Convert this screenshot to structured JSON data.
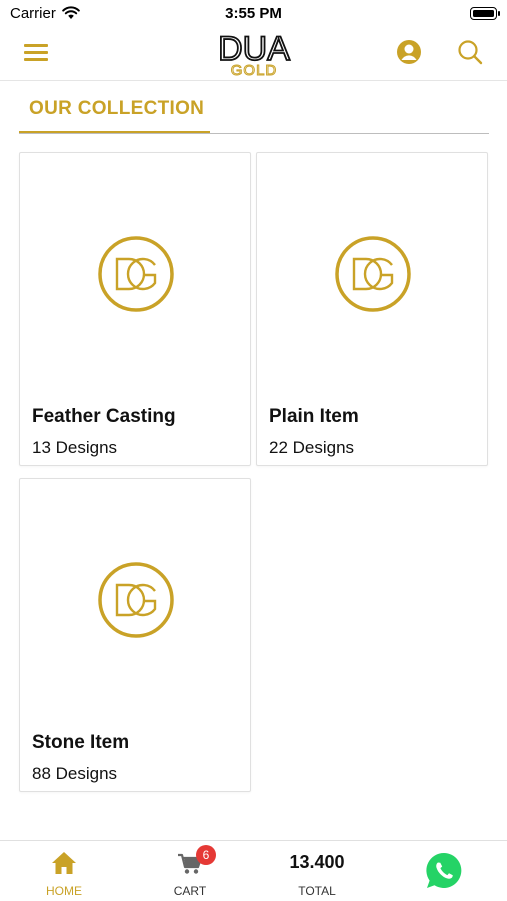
{
  "status_bar": {
    "carrier": "Carrier",
    "time": "3:55 PM"
  },
  "header": {
    "logo_text": "DUA",
    "logo_subtext": "GOLD"
  },
  "section": {
    "tab_label": "OUR COLLECTION"
  },
  "collections": [
    {
      "title": "Feather Casting",
      "count": "13 Designs"
    },
    {
      "title": "Plain Item",
      "count": "22 Designs"
    },
    {
      "title": "Stone Item",
      "count": "88 Designs"
    }
  ],
  "bottom_nav": {
    "home_label": "HOME",
    "cart_label": "CART",
    "cart_badge": "6",
    "total_value": "13.400",
    "total_label": "TOTAL"
  },
  "colors": {
    "accent": "#c9a227",
    "badge": "#e53935",
    "whatsapp": "#25d366"
  },
  "icons": [
    "wifi-icon",
    "battery-icon",
    "menu-icon",
    "profile-icon",
    "search-icon",
    "dg-logo-icon",
    "home-icon",
    "cart-icon",
    "whatsapp-icon"
  ]
}
